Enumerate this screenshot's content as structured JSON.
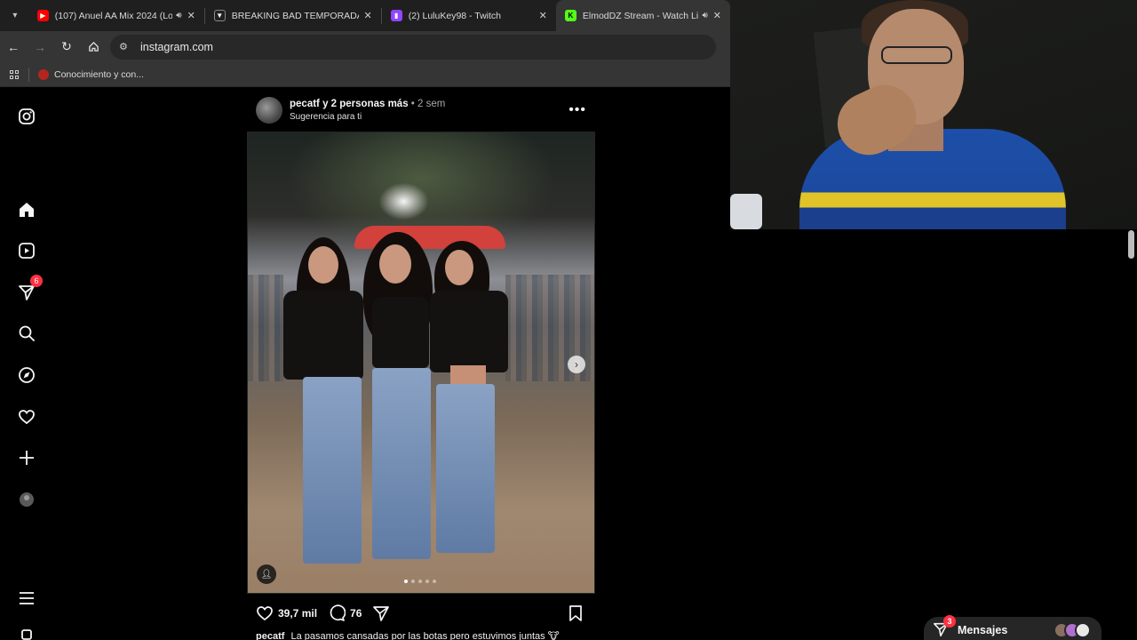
{
  "browser": {
    "tabs": [
      {
        "title": "(107) Anuel AA Mix 2024 (Lo",
        "favicon": "youtube-icon",
        "favicon_color": "#ff0000",
        "audio": true,
        "active": false
      },
      {
        "title": "BREAKING BAD TEMPORADA 4",
        "favicon": "shield-icon",
        "favicon_color": "#202020",
        "audio": false,
        "active": false
      },
      {
        "title": "(2) LuluKey98 - Twitch",
        "favicon": "twitch-icon",
        "favicon_color": "#9146ff",
        "audio": false,
        "active": false
      },
      {
        "title": "ElmodDZ Stream - Watch Li",
        "favicon": "kick-icon",
        "favicon_color": "#53fc18",
        "audio": true,
        "active": true
      }
    ],
    "address": "instagram.com",
    "bookmarks": [
      {
        "label": "Conocimiento y con..."
      }
    ]
  },
  "instagram": {
    "nav": [
      {
        "name": "instagram-logo-icon"
      },
      {
        "name": "home-icon"
      },
      {
        "name": "reels-icon"
      },
      {
        "name": "messages-icon",
        "badge": "6"
      },
      {
        "name": "search-icon"
      },
      {
        "name": "explore-icon"
      },
      {
        "name": "notifications-icon"
      },
      {
        "name": "create-icon"
      },
      {
        "name": "profile-avatar"
      },
      {
        "name": "menu-icon"
      },
      {
        "name": "threads-icon"
      }
    ],
    "post": {
      "user": "pecatf y 2 personas más",
      "time": "• 2 sem",
      "subtitle": "Sugerencia para ti",
      "likes": "39,7 mil",
      "comments": "76",
      "caption_user": "pecatf",
      "caption_text": "La pasamos cansadas por las botas pero estuvimos juntas 🐮",
      "carousel_count": 5,
      "carousel_index": 1
    },
    "messages_bar": {
      "label": "Mensajes",
      "badge": "3"
    }
  },
  "colors": {
    "accent_red": "#ff3040",
    "background": "#000000"
  }
}
